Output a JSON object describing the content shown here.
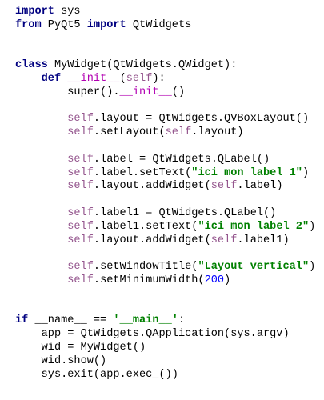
{
  "editor": {
    "lines": [
      [
        {
          "t": "import",
          "c": "kw"
        },
        {
          "t": " sys",
          "c": "plain"
        }
      ],
      [
        {
          "t": "from",
          "c": "kw"
        },
        {
          "t": " PyQt5 ",
          "c": "plain"
        },
        {
          "t": "import",
          "c": "kw"
        },
        {
          "t": " QtWidgets",
          "c": "plain"
        }
      ],
      [],
      [],
      [
        {
          "t": "class",
          "c": "kw"
        },
        {
          "t": " MyWidget(QtWidgets.QWidget):",
          "c": "plain"
        }
      ],
      [
        {
          "t": "    ",
          "c": "plain"
        },
        {
          "t": "def",
          "c": "kw"
        },
        {
          "t": " ",
          "c": "plain"
        },
        {
          "t": "__init__",
          "c": "dunder"
        },
        {
          "t": "(",
          "c": "plain"
        },
        {
          "t": "self",
          "c": "self"
        },
        {
          "t": "):",
          "c": "plain"
        }
      ],
      [
        {
          "t": "        super().",
          "c": "plain"
        },
        {
          "t": "__init__",
          "c": "dunder"
        },
        {
          "t": "()",
          "c": "plain"
        }
      ],
      [],
      [
        {
          "t": "        ",
          "c": "plain"
        },
        {
          "t": "self",
          "c": "self"
        },
        {
          "t": ".layout = QtWidgets.QVBoxLayout()",
          "c": "plain"
        }
      ],
      [
        {
          "t": "        ",
          "c": "plain"
        },
        {
          "t": "self",
          "c": "self"
        },
        {
          "t": ".setLayout(",
          "c": "plain"
        },
        {
          "t": "self",
          "c": "self"
        },
        {
          "t": ".layout)",
          "c": "plain"
        }
      ],
      [],
      [
        {
          "t": "        ",
          "c": "plain"
        },
        {
          "t": "self",
          "c": "self"
        },
        {
          "t": ".label = QtWidgets.QLabel()",
          "c": "plain"
        }
      ],
      [
        {
          "t": "        ",
          "c": "plain"
        },
        {
          "t": "self",
          "c": "self"
        },
        {
          "t": ".label.setText(",
          "c": "plain"
        },
        {
          "t": "\"ici mon label 1\"",
          "c": "str"
        },
        {
          "t": ")",
          "c": "plain"
        }
      ],
      [
        {
          "t": "        ",
          "c": "plain"
        },
        {
          "t": "self",
          "c": "self"
        },
        {
          "t": ".layout.addWidget(",
          "c": "plain"
        },
        {
          "t": "self",
          "c": "self"
        },
        {
          "t": ".label)",
          "c": "plain"
        }
      ],
      [],
      [
        {
          "t": "        ",
          "c": "plain"
        },
        {
          "t": "self",
          "c": "self"
        },
        {
          "t": ".label1 = QtWidgets.QLabel()",
          "c": "plain"
        }
      ],
      [
        {
          "t": "        ",
          "c": "plain"
        },
        {
          "t": "self",
          "c": "self"
        },
        {
          "t": ".label1.setText(",
          "c": "plain"
        },
        {
          "t": "\"ici mon label 2\"",
          "c": "str"
        },
        {
          "t": ")",
          "c": "plain"
        }
      ],
      [
        {
          "t": "        ",
          "c": "plain"
        },
        {
          "t": "self",
          "c": "self"
        },
        {
          "t": ".layout.addWidget(",
          "c": "plain"
        },
        {
          "t": "self",
          "c": "self"
        },
        {
          "t": ".label1)",
          "c": "plain"
        }
      ],
      [],
      [
        {
          "t": "        ",
          "c": "plain"
        },
        {
          "t": "self",
          "c": "self"
        },
        {
          "t": ".setWindowTitle(",
          "c": "plain"
        },
        {
          "t": "\"Layout vertical\"",
          "c": "str"
        },
        {
          "t": ")",
          "c": "plain"
        }
      ],
      [
        {
          "t": "        ",
          "c": "plain"
        },
        {
          "t": "self",
          "c": "self"
        },
        {
          "t": ".setMinimumWidth(",
          "c": "plain"
        },
        {
          "t": "200",
          "c": "num"
        },
        {
          "t": ")",
          "c": "plain"
        }
      ],
      [],
      [],
      [
        {
          "t": "if",
          "c": "kw"
        },
        {
          "t": " __name__ == ",
          "c": "plain"
        },
        {
          "t": "'__main__'",
          "c": "str"
        },
        {
          "t": ":",
          "c": "plain"
        }
      ],
      [
        {
          "t": "    app = QtWidgets.QApplication(sys.argv)",
          "c": "plain"
        }
      ],
      [
        {
          "t": "    wid = MyWidget()",
          "c": "plain"
        }
      ],
      [
        {
          "t": "    wid.show()",
          "c": "plain"
        }
      ],
      [
        {
          "t": "    sys.exit(app.exec_())",
          "c": "plain"
        }
      ]
    ]
  }
}
